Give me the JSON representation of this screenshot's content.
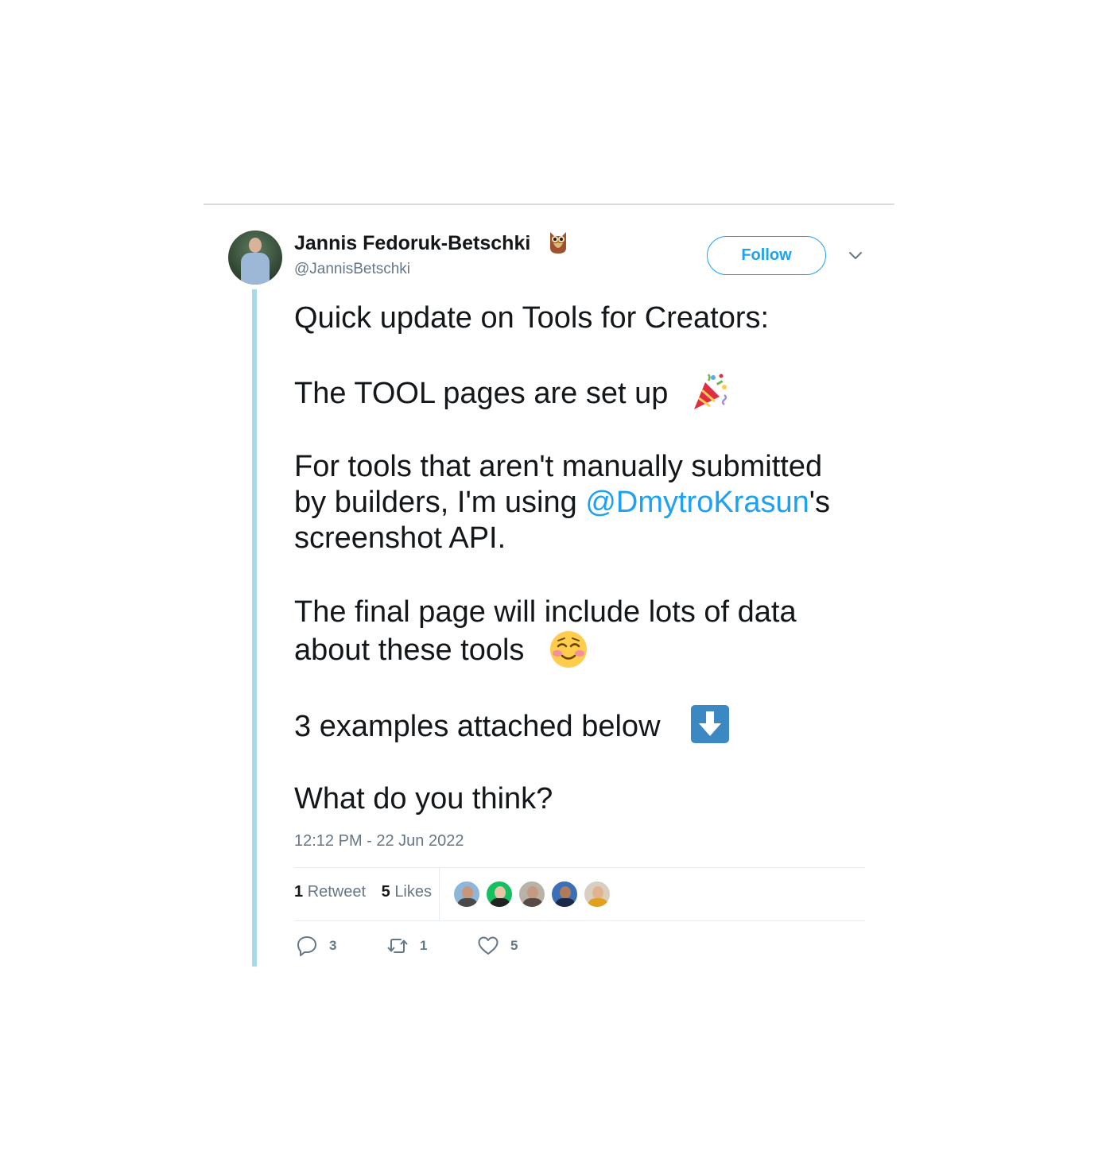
{
  "tweet": {
    "author_name": "Jannis Fedoruk-Betschki",
    "author_handle": "@JannisBetschki",
    "follow_label": "Follow",
    "text": {
      "line1": "Quick update on Tools for Creators:",
      "line2": "The TOOL pages are set up",
      "line3": "For tools that aren't manually submitted",
      "line4_prefix": "by builders, I'm using ",
      "line4_mention": "@DmytroKrasun",
      "line4_suffix": "'s",
      "line5": "screenshot API.",
      "line6": "The final page will include lots of data",
      "line7": "about these tools",
      "line8": "3 examples attached below",
      "line9": "What do you think?"
    },
    "timestamp": "12:12 PM - 22 Jun 2022",
    "stats": {
      "retweet_count": "1",
      "retweet_label": "Retweet",
      "like_count": "5",
      "like_label": "Likes"
    },
    "actions": {
      "reply_count": "3",
      "retweet_count": "1",
      "like_count": "5"
    },
    "icons": [
      "owl-icon",
      "party-popper-icon",
      "smiling-face-icon",
      "down-arrow-icon",
      "chevron-down-icon",
      "reply-icon",
      "retweet-icon",
      "heart-icon"
    ],
    "colors": {
      "accent": "#1da1f2",
      "thread_line": "#a8dbe9",
      "muted": "#657786",
      "text": "#14171a"
    }
  }
}
